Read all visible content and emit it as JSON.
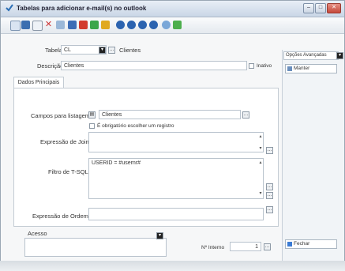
{
  "window": {
    "title": "Tabelas para adicionar e-mail(s) no outlook"
  },
  "toolbar": {
    "icons": [
      "new-icon",
      "open-icon",
      "copy-icon",
      "delete-icon",
      "edit-icon",
      "grid-icon",
      "filter-icon",
      "export-icon",
      "print-icon",
      "circle1-icon",
      "circle2-icon",
      "circle3-icon",
      "circle4-icon",
      "refresh-icon",
      "help-icon"
    ]
  },
  "form": {
    "tabela_label": "Tabela",
    "tabela_code": "CL",
    "tabela_name": "Clientes",
    "descricao_label": "Descrição",
    "descricao_value": "Clientes",
    "inativo_label": "Inativo"
  },
  "tabs": [
    {
      "label": "Dados Principais"
    }
  ],
  "fields": {
    "campos_listagem_label": "Campos para listagem",
    "campos_listagem_value": "Clientes",
    "obrigatorio_label": "É obrigatório escolher um registro",
    "expressao_join_label": "Expressão de Join",
    "expressao_join_value": "",
    "filtro_tsql_label": "Filtro de T-SQL",
    "filtro_tsql_value": "USERID = #usernr#",
    "expressao_ordem_label": "Expressão de Ordem",
    "expressao_ordem_value": "",
    "acesso_label": "Acesso",
    "acesso_value": "",
    "nr_label": "Nº Interno",
    "nr_value": "1"
  },
  "side": {
    "select_value": "Opções Avançadas",
    "top_button": "Manter",
    "bottom_button": "Fechar"
  }
}
